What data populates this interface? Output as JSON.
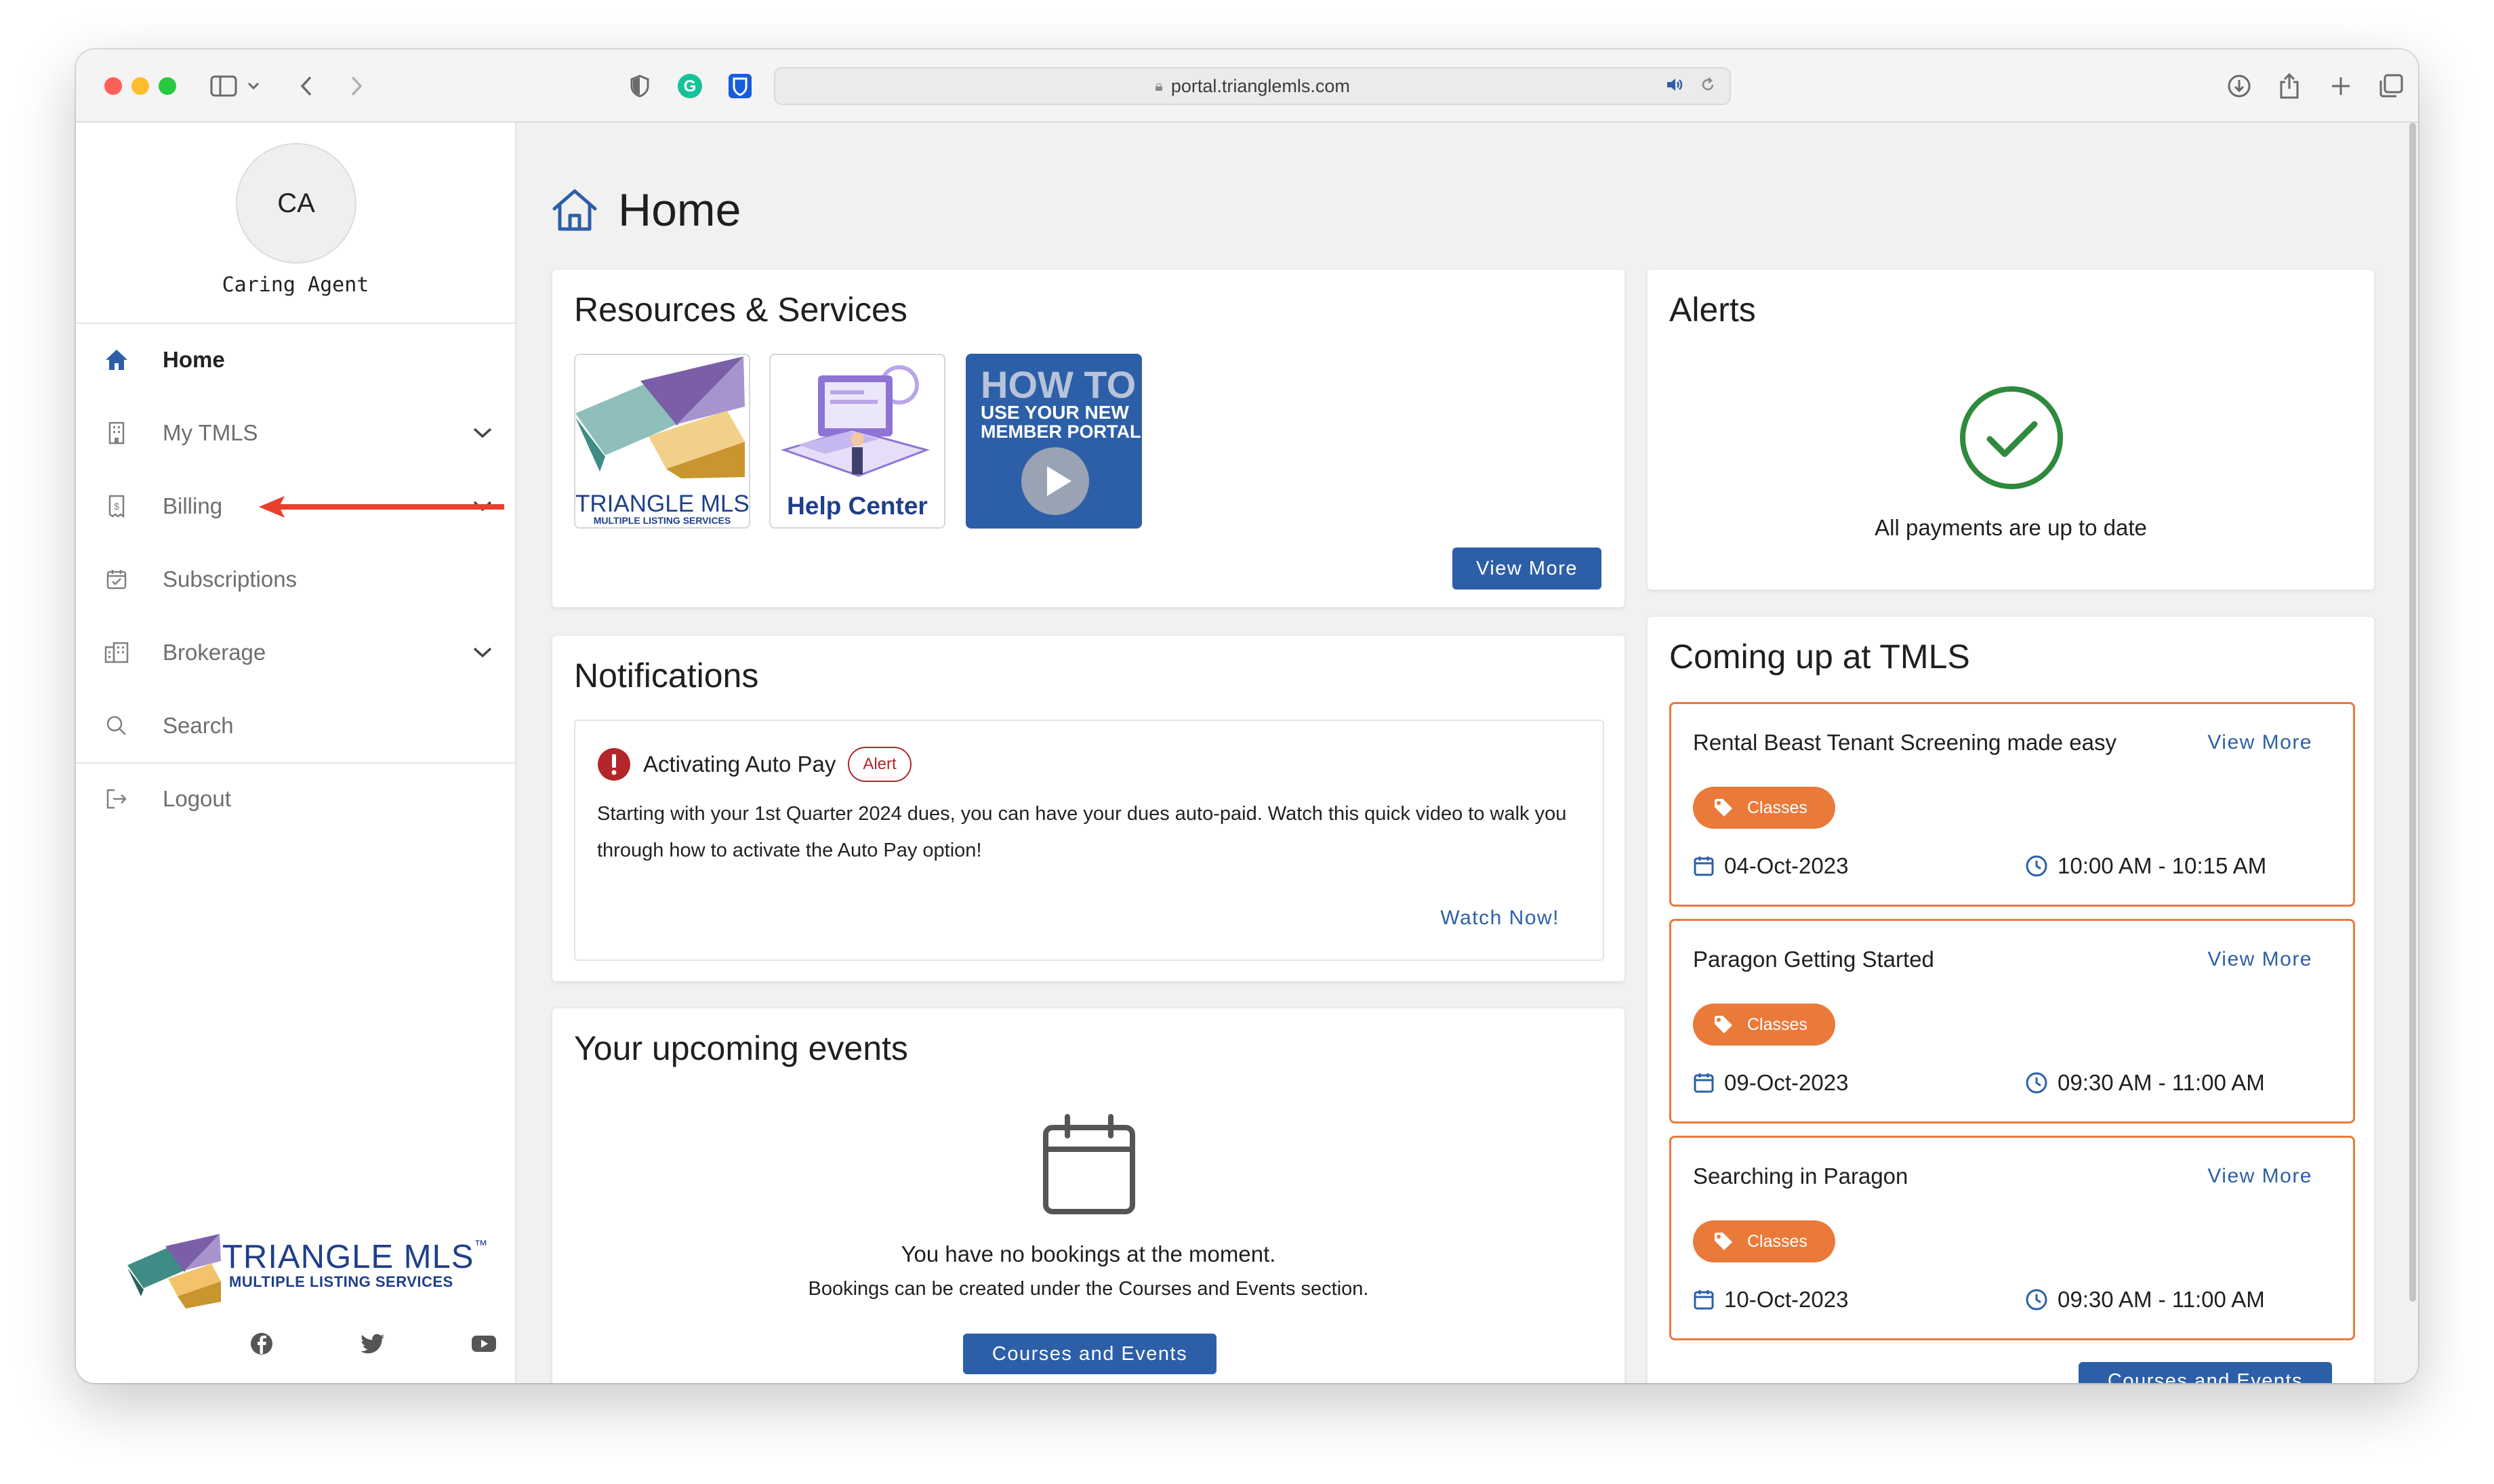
{
  "browser": {
    "url": "portal.trianglemls.com"
  },
  "user": {
    "initials": "CA",
    "name": "Caring Agent"
  },
  "sidebar": {
    "items": [
      {
        "label": "Home",
        "icon": "home-icon"
      },
      {
        "label": "My TMLS",
        "icon": "building-icon"
      },
      {
        "label": "Billing",
        "icon": "receipt-icon"
      },
      {
        "label": "Subscriptions",
        "icon": "calendar-check-icon"
      },
      {
        "label": "Brokerage",
        "icon": "office-icon"
      },
      {
        "label": "Search",
        "icon": "search-icon"
      },
      {
        "label": "Logout",
        "icon": "logout-icon"
      }
    ],
    "logo": {
      "line1": "TRIANGLE MLS",
      "tm": "™",
      "line2": "MULTIPLE LISTING SERVICES"
    }
  },
  "page": {
    "title": "Home"
  },
  "resources": {
    "title": "Resources & Services",
    "tiles": {
      "tmls": {
        "line1": "TRIANGLE MLS",
        "line2": "MULTIPLE LISTING SERVICES"
      },
      "help": {
        "label": "Help Center"
      },
      "howto": {
        "line1": "HOW TO",
        "line2": "USE YOUR NEW",
        "line3": "MEMBER PORTAL"
      }
    },
    "button": "View More"
  },
  "notifications": {
    "title": "Notifications",
    "item": {
      "title": "Activating Auto Pay",
      "badge": "Alert",
      "body": "Starting with your 1st Quarter 2024 dues, you can have your dues auto-paid. Watch this quick video to walk you through how to activate the Auto Pay option!",
      "link": "Watch Now!"
    }
  },
  "upcoming": {
    "title": "Your upcoming events",
    "empty_title": "You have no bookings at the moment.",
    "empty_sub": "Bookings can be created under the Courses and Events section.",
    "button": "Courses and Events"
  },
  "alerts": {
    "title": "Alerts",
    "message": "All payments are up to date"
  },
  "coming_up": {
    "title": "Coming up at TMLS",
    "events": [
      {
        "title": "Rental Beast Tenant Screening made easy",
        "more": "View More",
        "tag": "Classes",
        "date": "04-Oct-2023",
        "time": "10:00 AM - 10:15 AM"
      },
      {
        "title": "Paragon Getting Started",
        "more": "View More",
        "tag": "Classes",
        "date": "09-Oct-2023",
        "time": "09:30 AM - 11:00 AM"
      },
      {
        "title": "Searching in Paragon",
        "more": "View More",
        "tag": "Classes",
        "date": "10-Oct-2023",
        "time": "09:30 AM - 11:00 AM"
      }
    ],
    "button": "Courses and Events"
  },
  "colors": {
    "brand_blue": "#2d5fa8",
    "event_orange": "#ea7a3a",
    "alert_red": "#b3262c",
    "success_green": "#2e8a3c"
  }
}
